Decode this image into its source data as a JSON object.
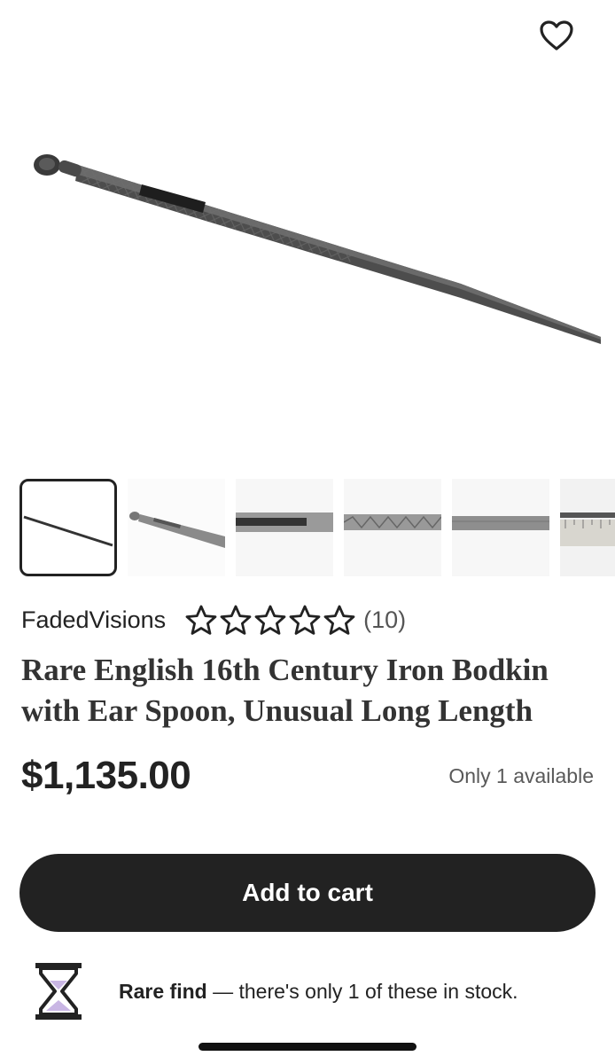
{
  "hero": {
    "favorite_icon": "heart-outline-icon",
    "image_subject": "iron-bodkin-with-ear-spoon"
  },
  "gallery": {
    "selected_index": 0,
    "thumbnails": [
      {
        "icon": "bodkin-full-view"
      },
      {
        "icon": "bodkin-spoon-end"
      },
      {
        "icon": "bodkin-slot-detail"
      },
      {
        "icon": "bodkin-pattern-detail"
      },
      {
        "icon": "bodkin-shaft-detail"
      },
      {
        "icon": "bodkin-ruler-scale"
      }
    ]
  },
  "shop": {
    "name": "FadedVisions",
    "rating": 5,
    "review_count": "(10)"
  },
  "listing": {
    "title": "Rare English 16th Century Iron Bodkin with Ear Spoon, Unusual Long Length",
    "price": "$1,135.00",
    "availability": "Only 1 available"
  },
  "actions": {
    "add_to_cart": "Add to cart"
  },
  "notice": {
    "icon": "hourglass-icon",
    "highlight": "Rare find",
    "text": " — there's only 1 of these in stock."
  },
  "colors": {
    "primary": "#222222",
    "background": "#ffffff",
    "hourglass_sand": "#c9b6e4"
  }
}
